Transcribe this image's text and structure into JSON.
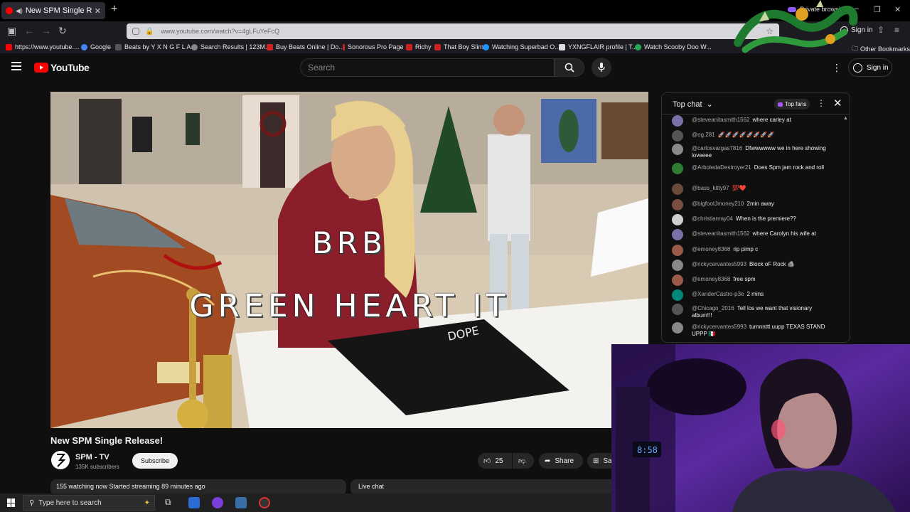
{
  "browser": {
    "tab_title": "New SPM Single Release -",
    "new_tab_glyph": "+",
    "private_label": "Private browsing",
    "url": "www.youtube.com/watch?v=4gLFuYeFcQ",
    "sign_in": "Sign in",
    "bookmarks": [
      {
        "label": "https://www.youtube....",
        "color": "#ff0000"
      },
      {
        "label": "Google",
        "color": "#4285f4"
      },
      {
        "label": "Beats by Y X N G F L A...",
        "color": "#555555"
      },
      {
        "label": "Search Results | 123M...",
        "color": "#888888"
      },
      {
        "label": "Buy Beats Online | Do...",
        "color": "#cc2222"
      },
      {
        "label": "Sonorous Pro Page",
        "color": "#cc2222"
      },
      {
        "label": "Richy",
        "color": "#cc2222"
      },
      {
        "label": "That Boy Slim",
        "color": "#cc2222"
      },
      {
        "label": "Watching Superbad O...",
        "color": "#1e90ff"
      },
      {
        "label": "YXNGFLAIR profile | T...",
        "color": "#dddddd"
      },
      {
        "label": "Watch Scooby Doo W...",
        "color": "#22aa55"
      }
    ],
    "other_bookmarks": "Other Bookmarks"
  },
  "youtube": {
    "logo_text": "YouTube",
    "search_placeholder": "Search",
    "sign_in": "Sign in"
  },
  "video": {
    "overlay_line1": "BRB",
    "overlay_line2": "GREEN HEART IT",
    "title": "New SPM Single Release!",
    "channel_name": "SPM - TV",
    "channel_subs": "135K subscribers",
    "subscribe": "Subscribe",
    "likes": "25",
    "share": "Share",
    "save_partial": "Sa",
    "description": "155 watching now  Started streaming 89 minutes ago",
    "live_chat_label": "Live chat"
  },
  "chat": {
    "mode": "Top chat",
    "top_fans": "Top fans",
    "messages": [
      {
        "author": "@steveanitasmith1562",
        "text": "where carley at",
        "avatar": "#7b6fa8"
      },
      {
        "author": "@og.281",
        "text": "🚀🚀🚀🚀🚀🚀🚀🚀",
        "avatar": "#555555"
      },
      {
        "author": "@carlosvargas7816",
        "text": "Dfwwwwww we in here showing loveeee",
        "avatar": "#8a8a8a"
      },
      {
        "author": "@ArboledaDestroyer21",
        "text": "Does Spm jam rock and roll",
        "avatar": "#2e7d32"
      },
      {
        "author": "@bass_kitty97",
        "text": "💯❤️",
        "avatar": "#6b4a3a"
      },
      {
        "author": "@bigfootJmoney210",
        "text": "2min away",
        "avatar": "#7a5040"
      },
      {
        "author": "@christianray04",
        "text": "When is the premiere??",
        "avatar": "#cfcfcf"
      },
      {
        "author": "@steveanitasmith1562",
        "text": "where Carolyn his wife at",
        "avatar": "#7b6fa8"
      },
      {
        "author": "@emoney8368",
        "text": "rip pimp c",
        "avatar": "#9a5a4a"
      },
      {
        "author": "@rickycervantes5993",
        "text": "Block oF Rock 🪨",
        "avatar": "#888888"
      },
      {
        "author": "@emoney8368",
        "text": "free spm",
        "avatar": "#9a5a4a"
      },
      {
        "author": "@XanderCastro-p3e",
        "text": "2 mins",
        "avatar": "#00897b"
      },
      {
        "author": "@Chicago_2016",
        "text": "Tell los we want that visionary album!!!",
        "avatar": "#555555"
      },
      {
        "author": "@rickycervantes5993",
        "text": "turnnnttt uupp TEXAS STAND UPPP 🇲🇽",
        "avatar": "#888888"
      }
    ]
  },
  "webcam": {
    "clock": "8:58"
  },
  "taskbar": {
    "search_placeholder": "Type here to search"
  },
  "colors": {
    "yt_red": "#ff0000",
    "bg": "#0f0f0f",
    "chip": "#272727"
  }
}
